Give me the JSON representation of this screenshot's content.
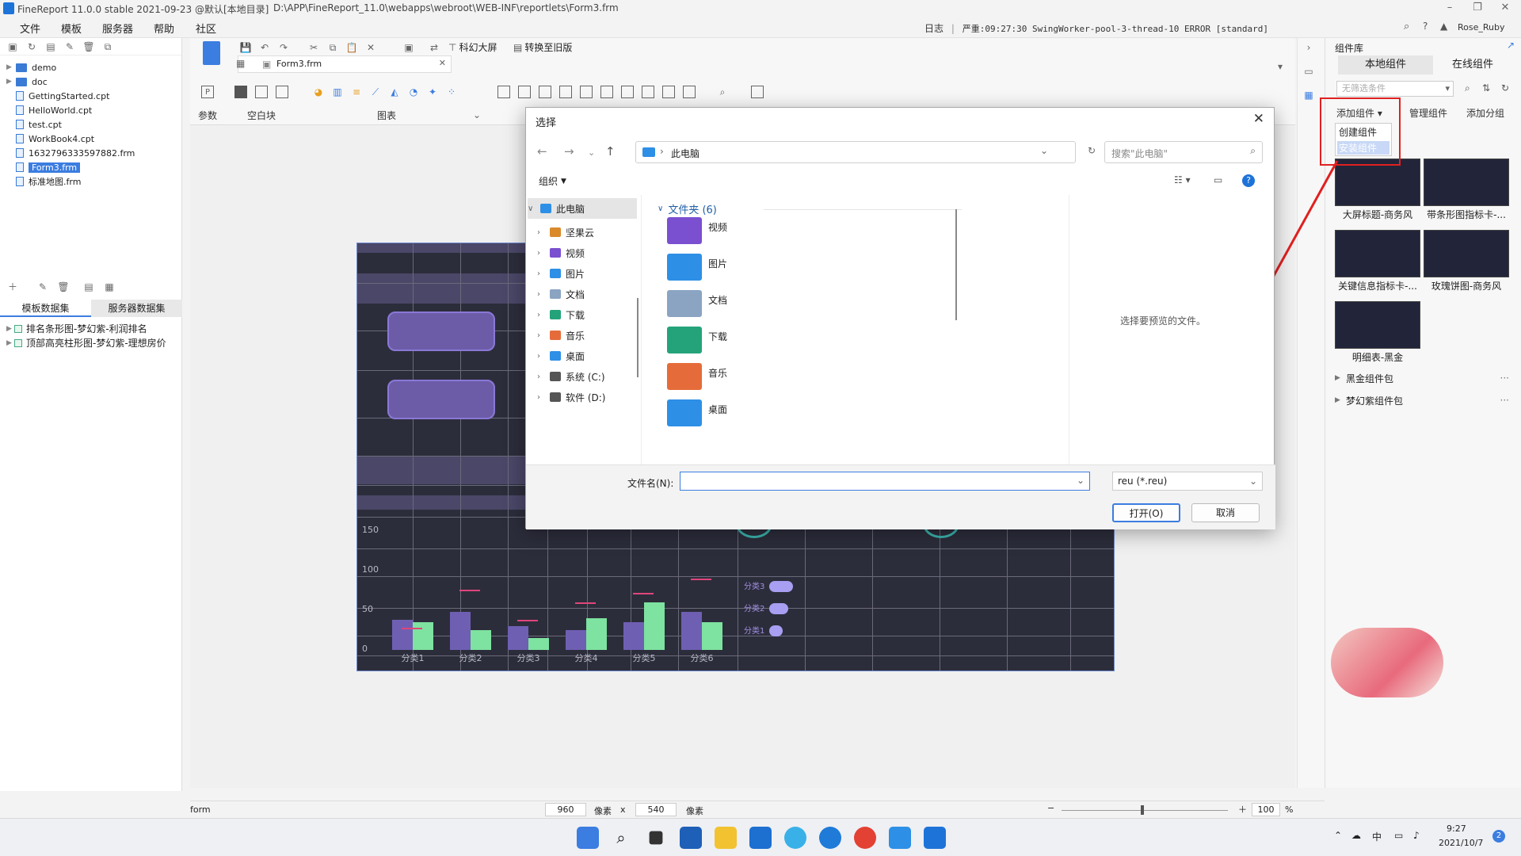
{
  "titlebar": {
    "app_title": "FineReport 11.0.0 stable 2021-09-23 @默认[本地目录]",
    "path": "D:\\APP\\FineReport_11.0\\webapps\\webroot\\WEB-INF\\reportlets\\Form3.frm"
  },
  "menubar": {
    "items": [
      "文件",
      "模板",
      "服务器",
      "帮助",
      "社区"
    ],
    "log_label": "日志",
    "log_error": "严重:09:27:30 SwingWorker-pool-3-thread-10 ERROR [standard]",
    "user": "Rose_Ruby"
  },
  "filetree": {
    "items": [
      {
        "label": "demo",
        "kind": "folder"
      },
      {
        "label": "doc",
        "kind": "folder"
      },
      {
        "label": "GettingStarted.cpt",
        "kind": "file"
      },
      {
        "label": "HelloWorld.cpt",
        "kind": "file"
      },
      {
        "label": "test.cpt",
        "kind": "file"
      },
      {
        "label": "WorkBook4.cpt",
        "kind": "file"
      },
      {
        "label": "1632796333597882.frm",
        "kind": "file"
      },
      {
        "label": "Form3.frm",
        "kind": "file",
        "selected": true
      },
      {
        "label": "标准地图.frm",
        "kind": "file"
      }
    ]
  },
  "datasets": {
    "tab_template": "模板数据集",
    "tab_server": "服务器数据集",
    "items": [
      "排名条形图-梦幻紫-利润排名",
      "顶部高亮柱形图-梦幻紫-理想房价"
    ]
  },
  "editor": {
    "tab_name": "Form3.frm",
    "btn_big_screen": "科幻大屏",
    "btn_convert": "转换至旧版",
    "group_param": "参数",
    "group_blank": "空白块",
    "group_chart": "图表"
  },
  "chart_data": {
    "type": "bar",
    "categories": [
      "分类1",
      "分类2",
      "分类3",
      "分类4",
      "分类5",
      "分类6"
    ],
    "series": [
      {
        "values": [
          38,
          48,
          30,
          25,
          35,
          48
        ],
        "color": "#6f5fb3"
      },
      {
        "values": [
          35,
          25,
          15,
          40,
          60,
          35
        ],
        "color": "#7ee2a0"
      }
    ],
    "markers": [
      28,
      76,
      38,
      60,
      72,
      90
    ],
    "ylim": [
      0,
      150
    ],
    "yticks": [
      0,
      50,
      100,
      150
    ],
    "side_labels": [
      "分类3",
      "分类2",
      "分类1"
    ],
    "side_values": [
      100,
      80,
      55
    ]
  },
  "rightpanel": {
    "title": "组件库",
    "tab_local": "本地组件",
    "tab_online": "在线组件",
    "filter_placeholder": "无筛选条件",
    "btn_add": "添加组件",
    "btn_manage": "管理组件",
    "btn_add_group": "添加分组",
    "add_menu": [
      "创建组件",
      "安装组件"
    ],
    "components": [
      "大屏标题-商务风",
      "带条形图指标卡-...",
      "关键信息指标卡-...",
      "玫瑰饼图-商务风",
      "明细表-黑金"
    ],
    "packages": [
      "黑金组件包",
      "梦幻紫组件包"
    ]
  },
  "status": {
    "mode": "form",
    "width": "960",
    "unit1": "像素",
    "x": "x",
    "height": "540",
    "unit2": "像素",
    "zoom": "100",
    "percent": "%"
  },
  "dialog": {
    "title": "选择",
    "address": "此电脑",
    "search_placeholder": "搜索\"此电脑\"",
    "organize": "组织",
    "folders_header": "文件夹 (6)",
    "nav": [
      "此电脑",
      "坚果云",
      "视频",
      "图片",
      "文档",
      "下载",
      "音乐",
      "桌面",
      "系统 (C:)",
      "软件 (D:)"
    ],
    "folders": [
      {
        "label": "视频",
        "color": "#7a4fd0"
      },
      {
        "label": "图片",
        "color": "#2d8fe6"
      },
      {
        "label": "文档",
        "color": "#8aa4c2"
      },
      {
        "label": "下载",
        "color": "#24a37a"
      },
      {
        "label": "音乐",
        "color": "#e56c3a"
      },
      {
        "label": "桌面",
        "color": "#2d8fe6"
      }
    ],
    "preview_text": "选择要预览的文件。",
    "filename_label": "文件名(N):",
    "filename_value": "",
    "filetype": "reu (*.reu)",
    "open_btn": "打开(O)",
    "cancel_btn": "取消"
  },
  "taskbar": {
    "time": "9:27",
    "date": "2021/10/7",
    "badge": "2"
  },
  "colors": {
    "accent": "#3b7de0",
    "red_highlight": "#e02020",
    "dashboard_bg": "#2c2d3b"
  }
}
